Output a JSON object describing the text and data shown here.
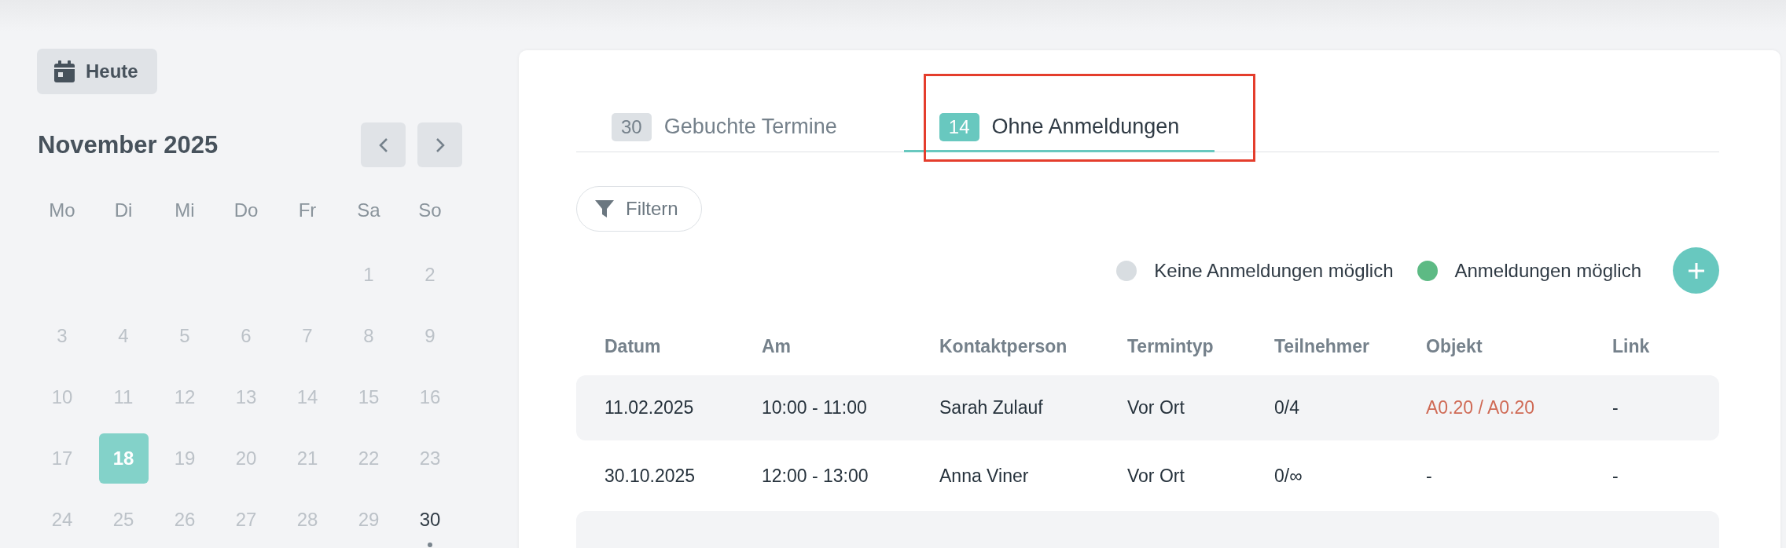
{
  "sidebar": {
    "today_button": "Heute",
    "month_title": "November 2025",
    "weekdays": [
      "Mo",
      "Di",
      "Mi",
      "Do",
      "Fr",
      "Sa",
      "So"
    ],
    "weeks": [
      {
        "days": [
          {
            "label": "1",
            "selected": false,
            "muted": true,
            "event": false
          },
          {
            "label": "2",
            "selected": false,
            "muted": true,
            "event": false
          }
        ]
      },
      {
        "days": [
          {
            "label": "3",
            "selected": false,
            "muted": true,
            "event": false
          },
          {
            "label": "4",
            "selected": false,
            "muted": true,
            "event": false
          },
          {
            "label": "5",
            "selected": false,
            "muted": true,
            "event": false
          },
          {
            "label": "6",
            "selected": false,
            "muted": true,
            "event": false
          },
          {
            "label": "7",
            "selected": false,
            "muted": true,
            "event": false
          },
          {
            "label": "8",
            "selected": false,
            "muted": true,
            "event": false
          },
          {
            "label": "9",
            "selected": false,
            "muted": true,
            "event": false
          }
        ]
      },
      {
        "days": [
          {
            "label": "10",
            "selected": false,
            "muted": true,
            "event": false
          },
          {
            "label": "11",
            "selected": false,
            "muted": true,
            "event": false
          },
          {
            "label": "12",
            "selected": false,
            "muted": true,
            "event": false
          },
          {
            "label": "13",
            "selected": false,
            "muted": true,
            "event": false
          },
          {
            "label": "14",
            "selected": false,
            "muted": true,
            "event": false
          },
          {
            "label": "15",
            "selected": false,
            "muted": true,
            "event": false
          },
          {
            "label": "16",
            "selected": false,
            "muted": true,
            "event": false
          }
        ]
      },
      {
        "days": [
          {
            "label": "17",
            "selected": false,
            "muted": true,
            "event": false
          },
          {
            "label": "18",
            "selected": true,
            "muted": false,
            "event": false
          },
          {
            "label": "19",
            "selected": false,
            "muted": true,
            "event": false
          },
          {
            "label": "20",
            "selected": false,
            "muted": true,
            "event": false
          },
          {
            "label": "21",
            "selected": false,
            "muted": true,
            "event": false
          },
          {
            "label": "22",
            "selected": false,
            "muted": true,
            "event": false
          },
          {
            "label": "23",
            "selected": false,
            "muted": true,
            "event": false
          }
        ]
      },
      {
        "days": [
          {
            "label": "24",
            "selected": false,
            "muted": true,
            "event": false
          },
          {
            "label": "25",
            "selected": false,
            "muted": true,
            "event": false
          },
          {
            "label": "26",
            "selected": false,
            "muted": true,
            "event": false
          },
          {
            "label": "27",
            "selected": false,
            "muted": true,
            "event": false
          },
          {
            "label": "28",
            "selected": false,
            "muted": true,
            "event": false
          },
          {
            "label": "29",
            "selected": false,
            "muted": true,
            "event": false
          },
          {
            "label": "30",
            "selected": false,
            "muted": false,
            "event": true
          }
        ]
      }
    ]
  },
  "tabs": [
    {
      "count": "30",
      "label": "Gebuchte Termine",
      "selected": false
    },
    {
      "count": "14",
      "label": "Ohne Anmeldungen",
      "selected": true
    }
  ],
  "filter_button": "Filtern",
  "legend": [
    {
      "label": "Keine Anmeldungen möglich",
      "color": "#d8dde1"
    },
    {
      "label": "Anmeldungen möglich",
      "color": "#5dba84"
    }
  ],
  "table": {
    "columns": [
      "Datum",
      "Am",
      "Kontaktperson",
      "Termintyp",
      "Teilnehmer",
      "Objekt",
      "Link"
    ],
    "rows": [
      {
        "cells": [
          "11.02.2025",
          "10:00 - 11:00",
          "Sarah Zulauf",
          "Vor Ort",
          "0/4"
        ],
        "object": {
          "text": "A0.20 / A0.20",
          "linked": true
        },
        "link": "-"
      },
      {
        "cells": [
          "30.10.2025",
          "12:00 - 13:00",
          "Anna Viner",
          "Vor Ort",
          "0/∞"
        ],
        "object": {
          "text": "-",
          "linked": false
        },
        "link": "-"
      }
    ]
  }
}
